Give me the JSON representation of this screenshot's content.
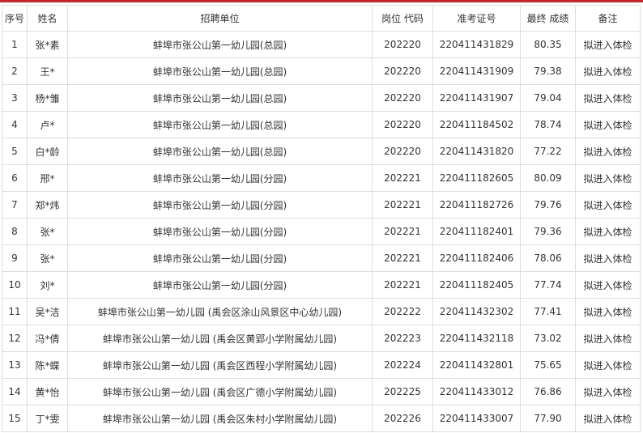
{
  "headers": [
    "序号",
    "姓名",
    "招聘单位",
    "岗位 代码",
    "准考证号",
    "最终 成绩",
    "备注"
  ],
  "rows": [
    [
      "1",
      "张*素",
      "蚌埠市张公山第一幼儿园(总园)",
      "202220",
      "220411431829",
      "80.35",
      "拟进入体检"
    ],
    [
      "2",
      "王*",
      "蚌埠市张公山第一幼儿园(总园)",
      "202220",
      "220411431909",
      "79.38",
      "拟进入体检"
    ],
    [
      "3",
      "杨*雏",
      "蚌埠市张公山第一幼儿园(总园)",
      "202220",
      "220411431907",
      "79.04",
      "拟进入体检"
    ],
    [
      "4",
      "卢*",
      "蚌埠市张公山第一幼儿园(总园)",
      "202220",
      "220411184502",
      "78.74",
      "拟进入体检"
    ],
    [
      "5",
      "白*龄",
      "蚌埠市张公山第一幼儿园(总园)",
      "202220",
      "220411431820",
      "77.22",
      "拟进入体检"
    ],
    [
      "6",
      "邢*",
      "蚌埠市张公山第一幼儿园(分园)",
      "202221",
      "220411182605",
      "80.09",
      "拟进入体检"
    ],
    [
      "7",
      "郑*炜",
      "蚌埠市张公山第一幼儿园(分园)",
      "202221",
      "220411182726",
      "79.76",
      "拟进入体检"
    ],
    [
      "8",
      "张*",
      "蚌埠市张公山第一幼儿园(分园)",
      "202221",
      "220411182401",
      "79.36",
      "拟进入体检"
    ],
    [
      "9",
      "张*",
      "蚌埠市张公山第一幼儿园(分园)",
      "202221",
      "220411182406",
      "78.06",
      "拟进入体检"
    ],
    [
      "10",
      "刘*",
      "蚌埠市张公山第一幼儿园(分园)",
      "202221",
      "220411182405",
      "77.74",
      "拟进入体检"
    ],
    [
      "11",
      "吴*洁",
      "蚌埠市张公山第一幼儿园 (禹会区涂山风景区中心幼儿园)",
      "202222",
      "220411432302",
      "77.41",
      "拟进入体检"
    ],
    [
      "12",
      "冯*倩",
      "蚌埠市张公山第一幼儿园 (禹会区黄郢小学附属幼儿园)",
      "202223",
      "220411432118",
      "73.02",
      "拟进入体检"
    ],
    [
      "13",
      "陈*蝶",
      "蚌埠市张公山第一幼儿园 (禹会区西程小学附属幼儿园)",
      "202224",
      "220411432801",
      "75.65",
      "拟进入体检"
    ],
    [
      "14",
      "黄*怡",
      "蚌埠市张公山第一幼儿园 (禹会区广德小学附属幼儿园)",
      "202225",
      "220411433012",
      "76.86",
      "拟进入体检"
    ],
    [
      "15",
      "丁*雯",
      "蚌埠市张公山第一幼儿园 (禹会区朱村小学附属幼儿园)",
      "202226",
      "220411433007",
      "77.90",
      "拟进入体检"
    ]
  ]
}
